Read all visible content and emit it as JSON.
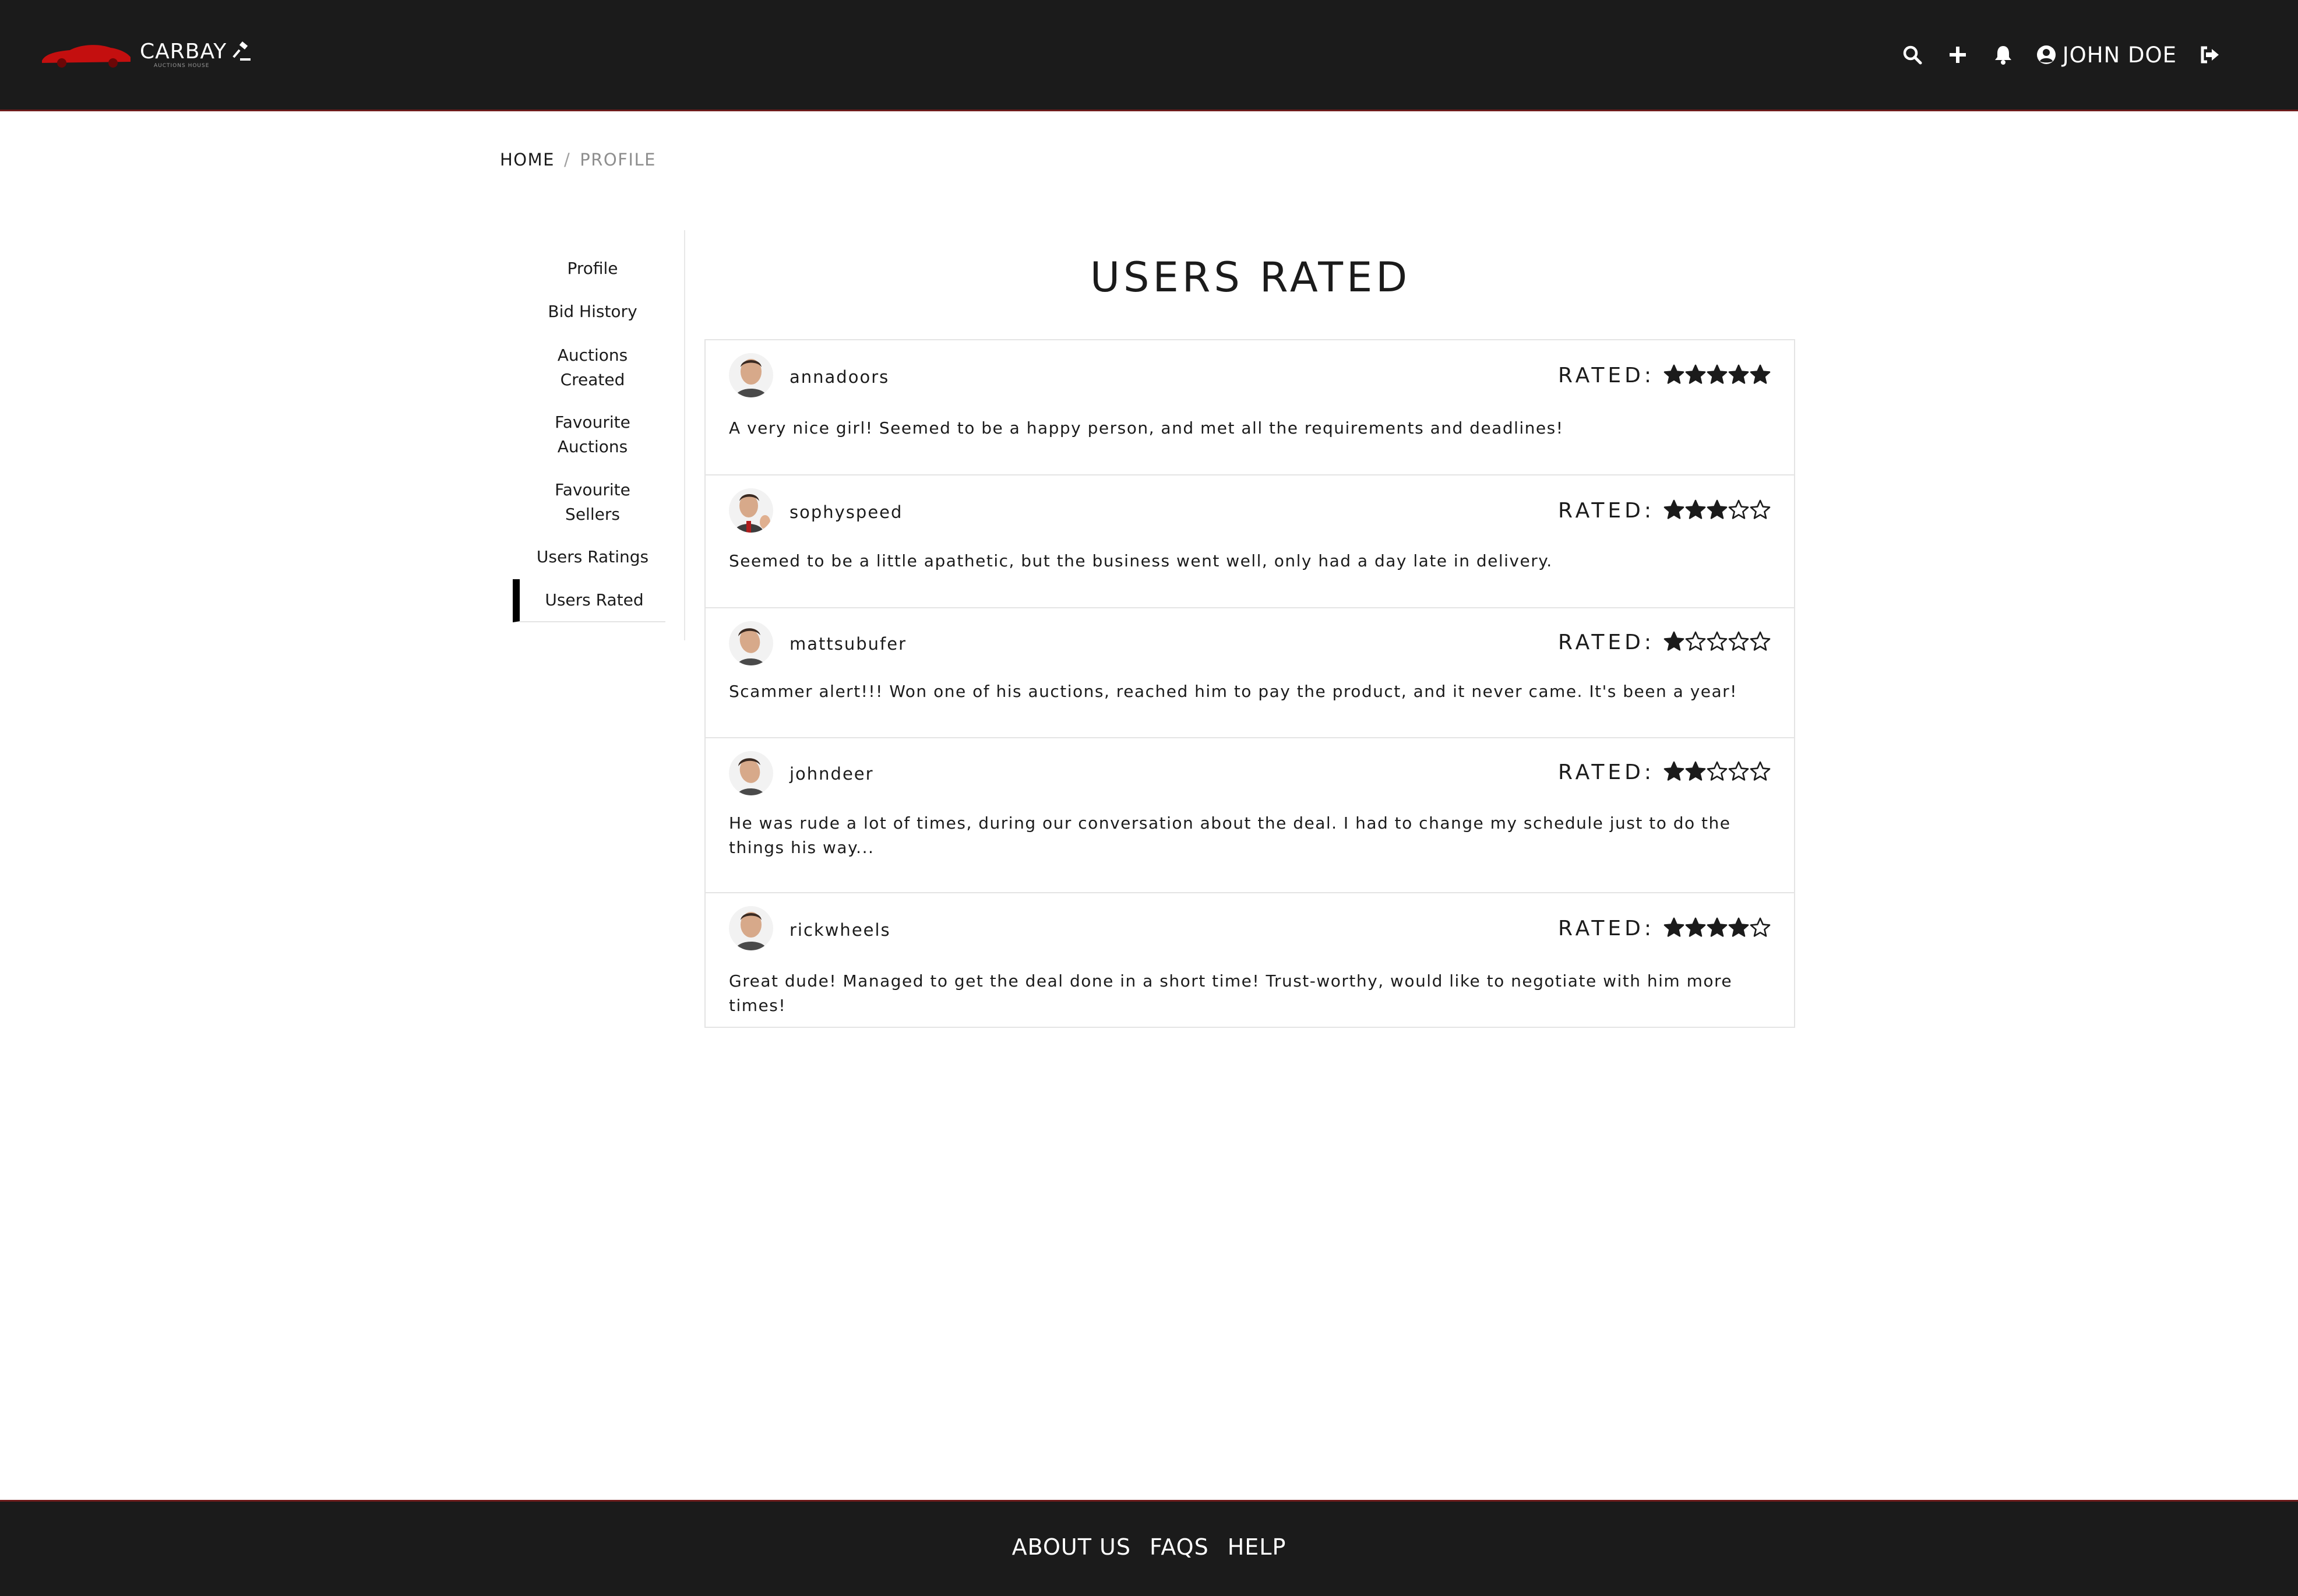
{
  "brand": {
    "name": "CARBAY",
    "tagline": "AUCTIONS HOUSE",
    "accent": "#c40f0f"
  },
  "header": {
    "icons": [
      "search-icon",
      "plus-icon",
      "bell-icon",
      "user-circle-icon",
      "logout-icon"
    ],
    "user_name": "JOHN DOE"
  },
  "breadcrumb": {
    "home": "HOME",
    "separator": "/",
    "current": "PROFILE"
  },
  "sidebar": {
    "items": [
      {
        "label": "Profile"
      },
      {
        "label": "Bid History"
      },
      {
        "label": "Auctions Created"
      },
      {
        "label": "Favourite Auctions"
      },
      {
        "label": "Favourite Sellers"
      },
      {
        "label": "Users Ratings"
      },
      {
        "label": "Users Rated",
        "active": true
      }
    ]
  },
  "main": {
    "title": "USERS RATED",
    "rated_label": "RATED:",
    "ratings": [
      {
        "username": "annadoors",
        "stars": 5,
        "max_stars": 5,
        "comment": "A very nice girl! Seemed to be a happy person, and met all the requirements and deadlines!"
      },
      {
        "username": "sophyspeed",
        "stars": 3,
        "max_stars": 5,
        "comment": "Seemed to be a little apathetic, but the business went well, only had a day late in delivery."
      },
      {
        "username": "mattsubufer",
        "stars": 1,
        "max_stars": 5,
        "comment": "Scammer alert!!! Won one of his auctions, reached him to pay the product, and it never came. It's been a year!"
      },
      {
        "username": "johndeer",
        "stars": 2,
        "max_stars": 5,
        "comment": "He was rude a lot of times, during our conversation about the deal. I had to change my schedule just to do the things his way..."
      },
      {
        "username": "rickwheels",
        "stars": 4,
        "max_stars": 5,
        "comment": "Great dude! Managed to get the deal done in a short time! Trust-worthy, would like to negotiate with him more times!"
      }
    ]
  },
  "footer": {
    "links": [
      "ABOUT US",
      "FAQS",
      "HELP"
    ]
  }
}
